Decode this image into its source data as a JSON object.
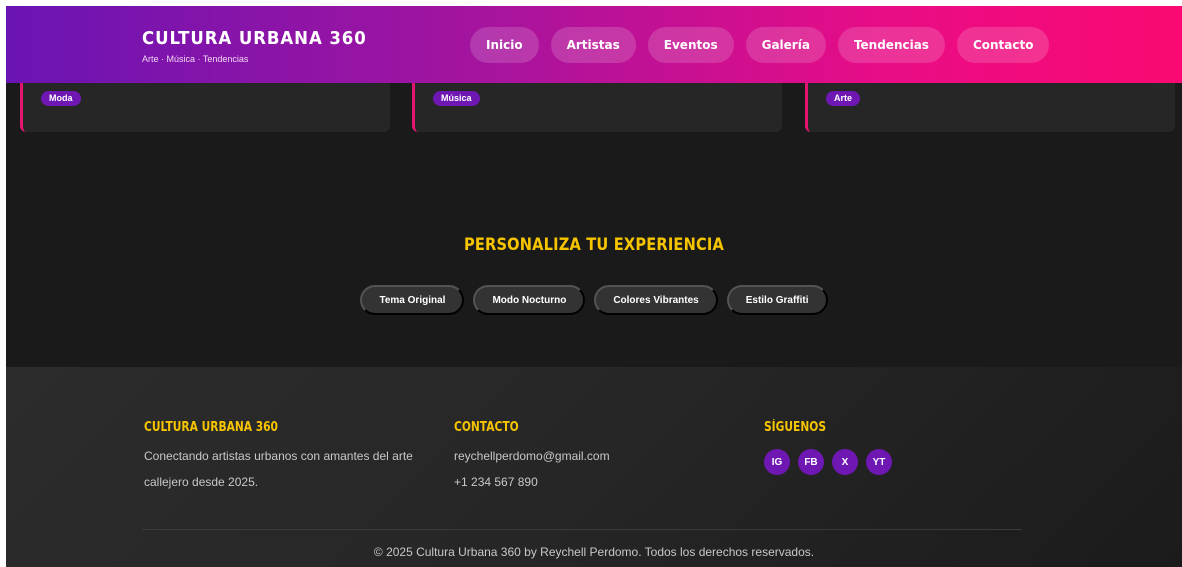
{
  "header": {
    "title": "CULTURA URBANA 360",
    "subtitle": "Arte · Música · Tendencias",
    "nav": [
      "Inicio",
      "Artistas",
      "Eventos",
      "Galería",
      "Tendencias",
      "Contacto"
    ]
  },
  "cards": [
    {
      "tag": "Moda"
    },
    {
      "tag": "Música"
    },
    {
      "tag": "Arte"
    }
  ],
  "personalize": {
    "title": "PERSONALIZA TU EXPERIENCIA",
    "themes": [
      "Tema Original",
      "Modo Nocturno",
      "Colores Vibrantes",
      "Estilo Graffiti"
    ]
  },
  "footer": {
    "about": {
      "title": "CULTURA URBANA 360",
      "text": "Conectando artistas urbanos con amantes del arte callejero desde 2025."
    },
    "contact": {
      "title": "CONTACTO",
      "email": "reychellperdomo@gmail.com",
      "phone": "+1 234 567 890"
    },
    "follow": {
      "title": "SÍGUENOS",
      "networks": [
        "IG",
        "FB",
        "X",
        "YT"
      ]
    },
    "copyright": "© 2025 Cultura Urbana 360 by Reychell Perdomo. Todos los derechos reservados."
  },
  "colors": {
    "accent_yellow": "#f7c500",
    "accent_purple": "#6f17b3",
    "accent_pink": "#e3166f",
    "background": "#1a1a1a"
  }
}
